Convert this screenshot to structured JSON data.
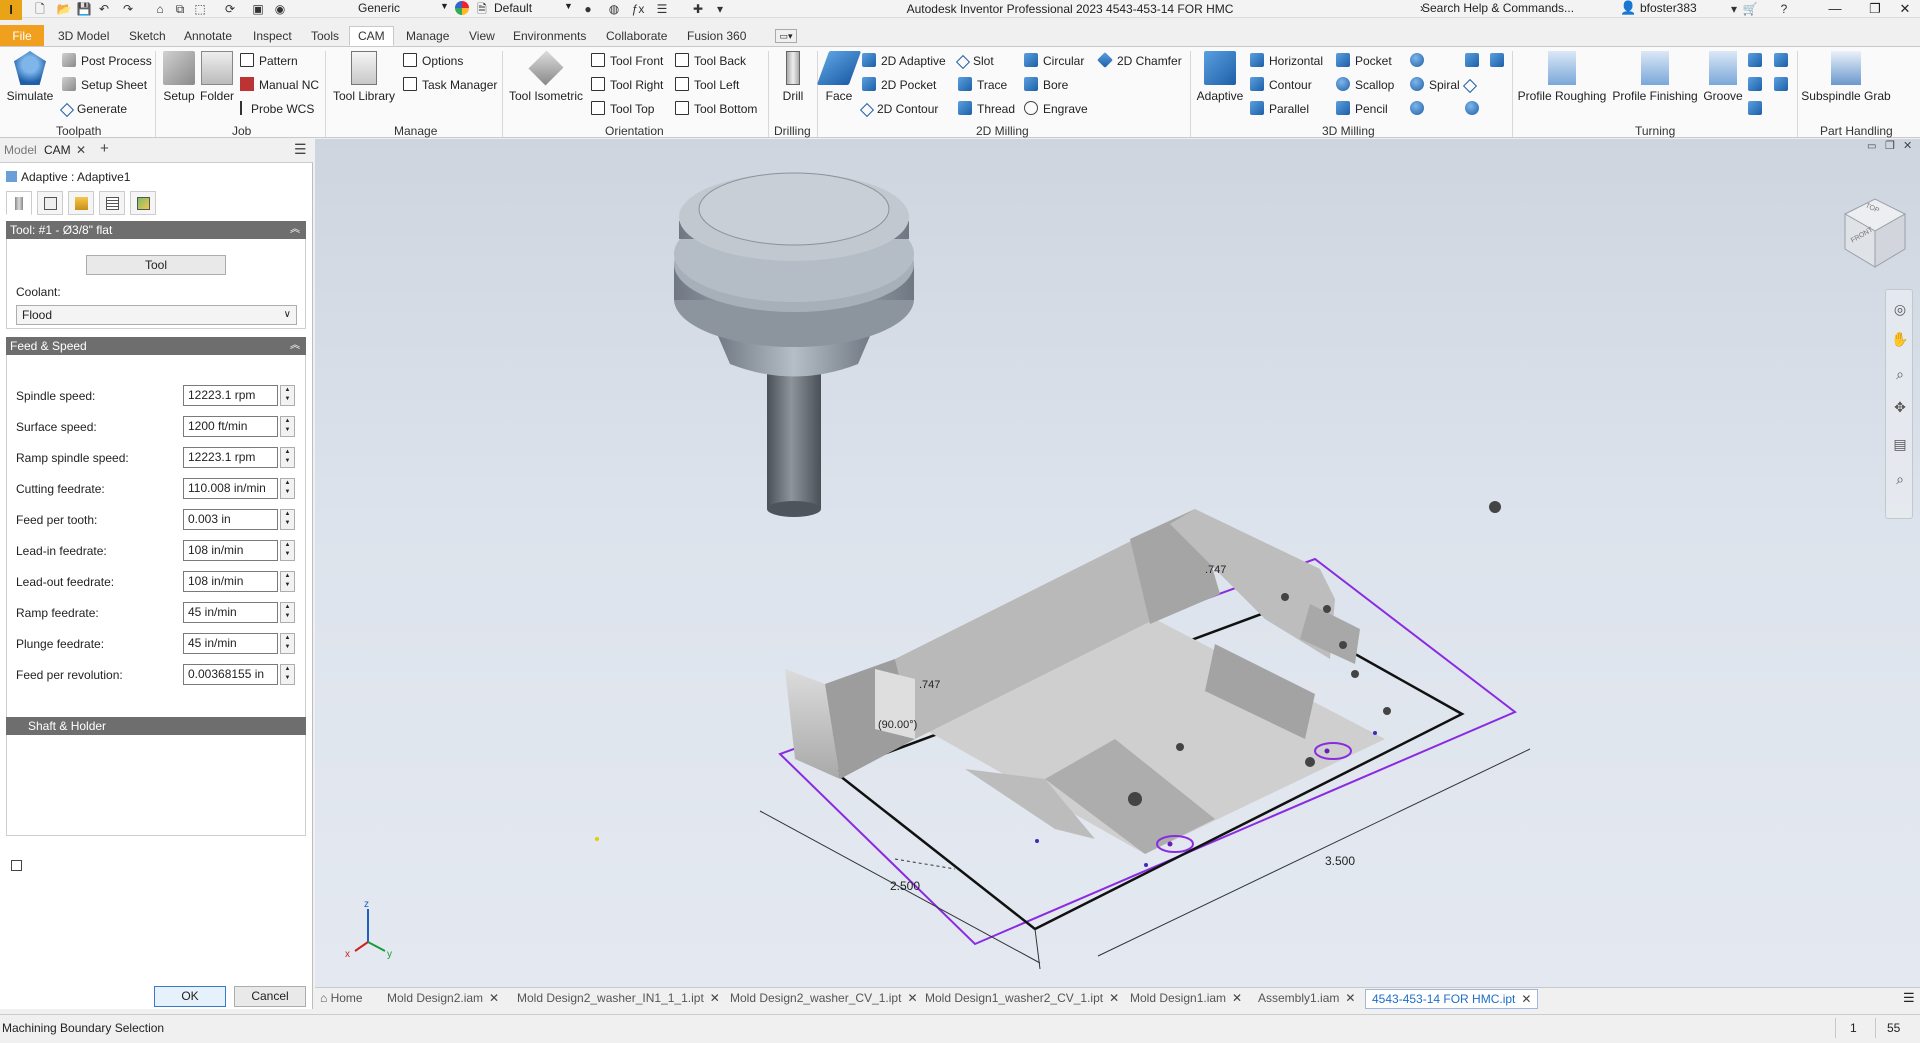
{
  "titlebar": {
    "app_logo": "I",
    "title": "Autodesk Inventor Professional 2023    4543-453-14 FOR HMC",
    "material": "Generic",
    "appearance": "Default",
    "search_placeholder": "Search Help & Commands...",
    "user": "bfoster383",
    "qa_icons": [
      "new-icon",
      "open-icon",
      "save-icon",
      "undo-icon",
      "redo-icon",
      "home-icon",
      "update-icon",
      "select-icon",
      "measure-icon",
      "generic-icon"
    ]
  },
  "ribbon_tabs": [
    "File",
    "3D Model",
    "Sketch",
    "Annotate",
    "Inspect",
    "Tools",
    "CAM",
    "Manage",
    "View",
    "Environments",
    "Collaborate",
    "Fusion 360"
  ],
  "active_ribbon_tab": "CAM",
  "ribbon": {
    "toolpath": {
      "label": "Toolpath",
      "simulate": "Simulate",
      "post_process": "Post Process",
      "setup_sheet": "Setup Sheet",
      "generate": "Generate"
    },
    "job": {
      "label": "Job",
      "setup": "Setup",
      "folder": "Folder",
      "pattern": "Pattern",
      "manual_nc": "Manual NC",
      "probe_wcs": "Probe WCS"
    },
    "manage": {
      "label": "Manage",
      "tool_library": "Tool Library",
      "options": "Options",
      "task_manager": "Task Manager"
    },
    "orientation": {
      "label": "Orientation",
      "tool_isometric": "Tool Isometric",
      "tool_front": "Tool Front",
      "tool_back": "Tool Back",
      "tool_right": "Tool Right",
      "tool_left": "Tool Left",
      "tool_top": "Tool Top",
      "tool_bottom": "Tool Bottom"
    },
    "drilling": {
      "label": "Drilling",
      "drill": "Drill"
    },
    "milling2d": {
      "label": "2D Milling",
      "face": "Face",
      "adaptive_2d": "2D Adaptive",
      "pocket_2d": "2D Pocket",
      "contour_2d": "2D Contour",
      "slot": "Slot",
      "trace": "Trace",
      "thread": "Thread",
      "circular": "Circular",
      "bore": "Bore",
      "engrave": "Engrave",
      "chamfer_2d": "2D Chamfer"
    },
    "milling3d": {
      "label": "3D Milling",
      "adaptive": "Adaptive",
      "horizontal": "Horizontal",
      "contour": "Contour",
      "parallel": "Parallel",
      "pocket": "Pocket",
      "scallop": "Scallop",
      "pencil": "Pencil",
      "spiral": "Spiral"
    },
    "turning": {
      "label": "Turning",
      "profile_roughing": "Profile Roughing",
      "profile_finishing": "Profile Finishing",
      "groove": "Groove"
    },
    "part_handling": {
      "label": "Part Handling",
      "subspindle_grab": "Subspindle Grab"
    }
  },
  "browser": {
    "tabs": [
      "Model",
      "CAM"
    ],
    "add_tab": "+",
    "operation": "Adaptive : Adaptive1",
    "tool_section": {
      "header": "Tool: #1 - Ø3/8\" flat",
      "tool_button": "Tool",
      "coolant_label": "Coolant:",
      "coolant_value": "Flood"
    },
    "feed_speed": {
      "header": "Feed & Speed",
      "fields": [
        {
          "label": "Spindle speed:",
          "value": "12223.1 rpm"
        },
        {
          "label": "Surface speed:",
          "value": "1200 ft/min"
        },
        {
          "label": "Ramp spindle speed:",
          "value": "12223.1 rpm"
        },
        {
          "label": "Cutting feedrate:",
          "value": "110.008 in/min"
        },
        {
          "label": "Feed per tooth:",
          "value": "0.003 in"
        },
        {
          "label": "Lead-in feedrate:",
          "value": "108 in/min"
        },
        {
          "label": "Lead-out feedrate:",
          "value": "108 in/min"
        },
        {
          "label": "Ramp feedrate:",
          "value": "45 in/min"
        },
        {
          "label": "Plunge feedrate:",
          "value": "45 in/min"
        },
        {
          "label": "Feed per revolution:",
          "value": "0.00368155 in"
        }
      ]
    },
    "shaft_holder": "Shaft & Holder",
    "ok": "OK",
    "cancel": "Cancel"
  },
  "viewport": {
    "dim_747_a": ".747",
    "dim_747_b": ".747",
    "dim_angle": "(90.00°)",
    "dim_width": "2.500",
    "dim_length": "3.500",
    "viewcube_face": "FRONT",
    "viewcube_top": "TOP"
  },
  "doc_tabs": [
    {
      "label": "Home",
      "active": false
    },
    {
      "label": "Mold Design2.iam",
      "active": false
    },
    {
      "label": "Mold Design2_washer_IN1_1_1.ipt",
      "active": false
    },
    {
      "label": "Mold Design2_washer_CV_1.ipt",
      "active": false
    },
    {
      "label": "Mold Design1_washer2_CV_1.ipt",
      "active": false
    },
    {
      "label": "Mold Design1.iam",
      "active": false
    },
    {
      "label": "Assembly1.iam",
      "active": false
    },
    {
      "label": "4543-453-14 FOR HMC.ipt",
      "active": true
    }
  ],
  "status": {
    "text": "Machining Boundary Selection",
    "num1": "1",
    "num2": "55"
  },
  "colors": {
    "accent": "#f0a01e",
    "boundary": "#8a2be2",
    "part": "#c2c2c2",
    "tool": "#9aa3ad"
  }
}
